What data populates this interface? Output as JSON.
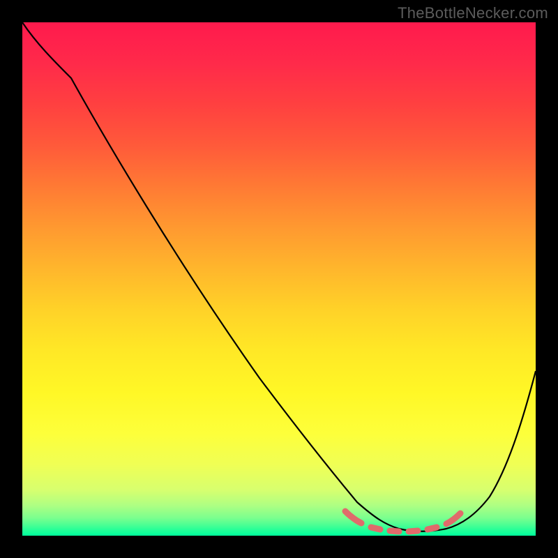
{
  "watermark": "TheBottleNecker.com",
  "chart_data": {
    "type": "line",
    "title": "",
    "xlabel": "",
    "ylabel": "",
    "xlim": [
      0,
      100
    ],
    "ylim": [
      0,
      100
    ],
    "curve": {
      "name": "bottleneck-curve",
      "x": [
        0,
        5,
        10,
        20,
        30,
        40,
        50,
        58,
        62,
        66,
        70,
        74,
        78,
        82,
        86,
        90,
        94,
        98,
        100
      ],
      "y": [
        100,
        96,
        92,
        80,
        66,
        52,
        38,
        24,
        17,
        10,
        5,
        2.5,
        1.5,
        1.5,
        2.5,
        5,
        12,
        25,
        33
      ]
    },
    "optimal_band": {
      "name": "optimal-range-markers",
      "x_start": 63,
      "x_end": 85,
      "y": 4.5
    },
    "gradient_stops": [
      {
        "pos": 0.0,
        "color": "#ff1a4d"
      },
      {
        "pos": 0.4,
        "color": "#ff9930"
      },
      {
        "pos": 0.72,
        "color": "#fff726"
      },
      {
        "pos": 1.0,
        "color": "#00ff9c"
      }
    ]
  }
}
